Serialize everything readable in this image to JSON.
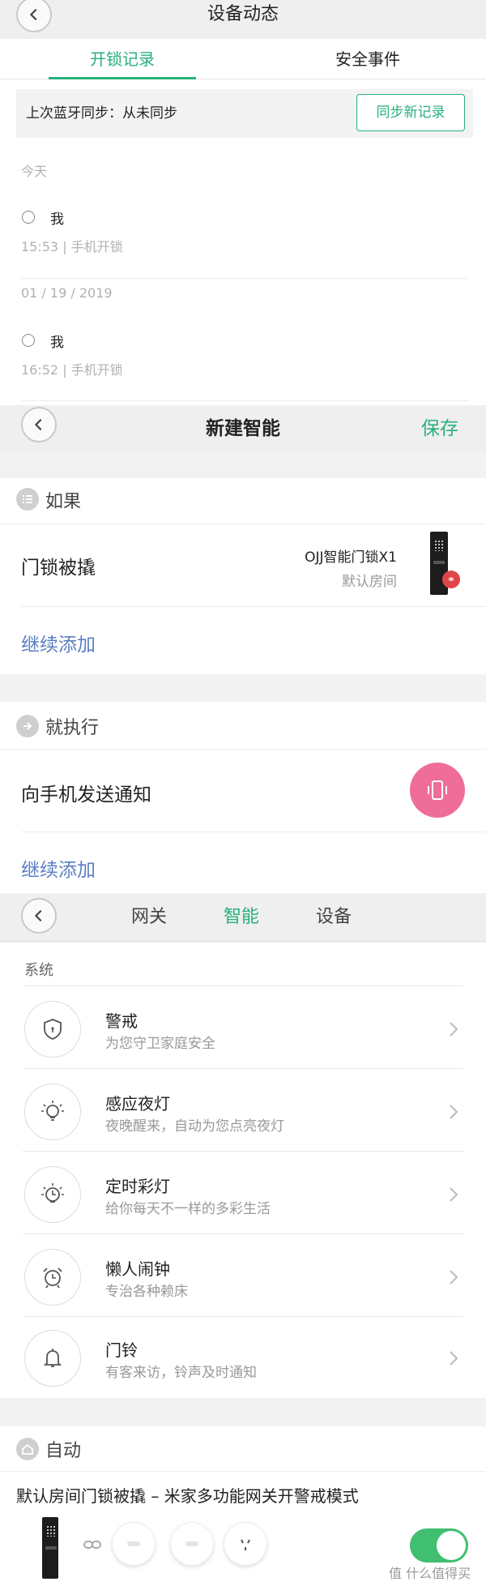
{
  "device_activity": {
    "title": "设备动态",
    "tabs": [
      "开锁记录",
      "安全事件"
    ],
    "active_tab": 0,
    "sync_label": "上次蓝牙同步：从未同步",
    "sync_button": "同步新记录",
    "groups": [
      {
        "date": "今天",
        "user": "我",
        "meta": "15:53 | 手机开锁"
      },
      {
        "date": "01 / 19 / 2019",
        "user": "我",
        "meta": "16:52 | 手机开锁"
      }
    ]
  },
  "new_automation": {
    "title": "新建智能",
    "save": "保存",
    "if_label": "如果",
    "if_condition": "门锁被撬",
    "device_name": "OJJ智能门锁X1",
    "device_room": "默认房间",
    "add_more": "继续添加",
    "then_label": "就执行",
    "then_action": "向手机发送通知",
    "add_more_2": "继续添加"
  },
  "gateway": {
    "tabs": [
      "网关",
      "智能",
      "设备"
    ],
    "active_tab": 1,
    "system_label": "系统",
    "items": [
      {
        "name": "警戒",
        "desc": "为您守卫家庭安全",
        "icon": "shield-icon"
      },
      {
        "name": "感应夜灯",
        "desc": "夜晚醒来，自动为您点亮夜灯",
        "icon": "bulb-icon"
      },
      {
        "name": "定时彩灯",
        "desc": "给你每天不一样的多彩生活",
        "icon": "timer-bulb-icon"
      },
      {
        "name": "懒人闹钟",
        "desc": "专治各种赖床",
        "icon": "alarm-clock-icon"
      },
      {
        "name": "门铃",
        "desc": "有客来访，铃声及时通知",
        "icon": "bell-icon"
      }
    ],
    "auto_label": "自动",
    "auto_rule": "默认房间门锁被撬 – 米家多功能网关开警戒模式",
    "auto_enabled": true,
    "watermark": "值 什么值得买"
  },
  "colors": {
    "accent": "#29b07c",
    "link": "#5a7fc2",
    "notify": "#ee6d99",
    "badge": "#e0454a",
    "toggle": "#3fbf6f"
  }
}
